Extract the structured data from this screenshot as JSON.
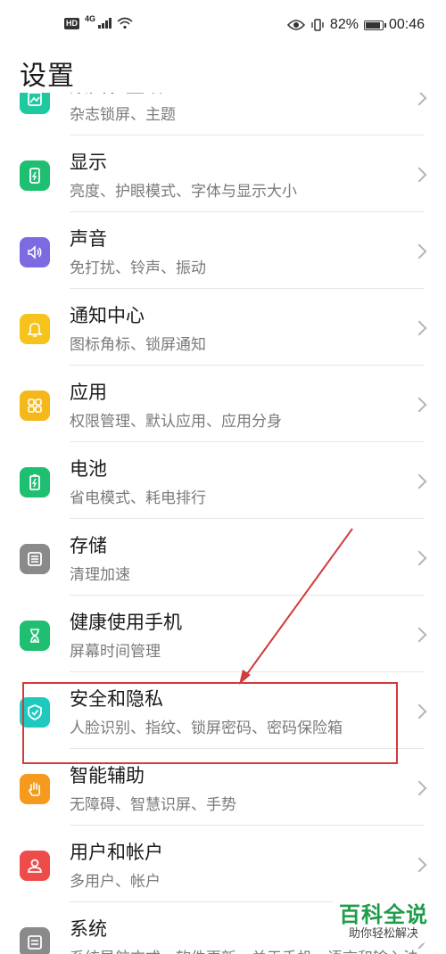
{
  "status_bar": {
    "hd": "HD",
    "network": "4G",
    "battery_percent": "82%",
    "time": "00:46"
  },
  "page_title": "设置",
  "items": [
    {
      "title": "桌面和壁纸",
      "subtitle": "杂志锁屏、主题",
      "icon": "wallpaper-icon",
      "color": "#1ec9a0"
    },
    {
      "title": "显示",
      "subtitle": "亮度、护眼模式、字体与显示大小",
      "icon": "display-icon",
      "color": "#1fbf72"
    },
    {
      "title": "声音",
      "subtitle": "免打扰、铃声、振动",
      "icon": "speaker-icon",
      "color": "#7b6ae0"
    },
    {
      "title": "通知中心",
      "subtitle": "图标角标、锁屏通知",
      "icon": "bell-icon",
      "color": "#f6c21c"
    },
    {
      "title": "应用",
      "subtitle": "权限管理、默认应用、应用分身",
      "icon": "apps-grid-icon",
      "color": "#f4b81a"
    },
    {
      "title": "电池",
      "subtitle": "省电模式、耗电排行",
      "icon": "battery-icon",
      "color": "#1fbf72"
    },
    {
      "title": "存储",
      "subtitle": "清理加速",
      "icon": "storage-icon",
      "color": "#8a8a8a"
    },
    {
      "title": "健康使用手机",
      "subtitle": "屏幕时间管理",
      "icon": "hourglass-icon",
      "color": "#1fbf72"
    },
    {
      "title": "安全和隐私",
      "subtitle": "人脸识别、指纹、锁屏密码、密码保险箱",
      "icon": "shield-icon",
      "color": "#1ec9c0"
    },
    {
      "title": "智能辅助",
      "subtitle": "无障碍、智慧识屏、手势",
      "icon": "hand-icon",
      "color": "#f59a1c"
    },
    {
      "title": "用户和帐户",
      "subtitle": "多用户、帐户",
      "icon": "user-icon",
      "color": "#ee4b4b"
    },
    {
      "title": "系统",
      "subtitle": "系统导航方式、软件更新、关于手机、语言和输入法",
      "icon": "system-icon",
      "color": "#8a8a8a"
    }
  ],
  "watermark": {
    "main": "百科全说",
    "sub": "助你轻松解决"
  }
}
